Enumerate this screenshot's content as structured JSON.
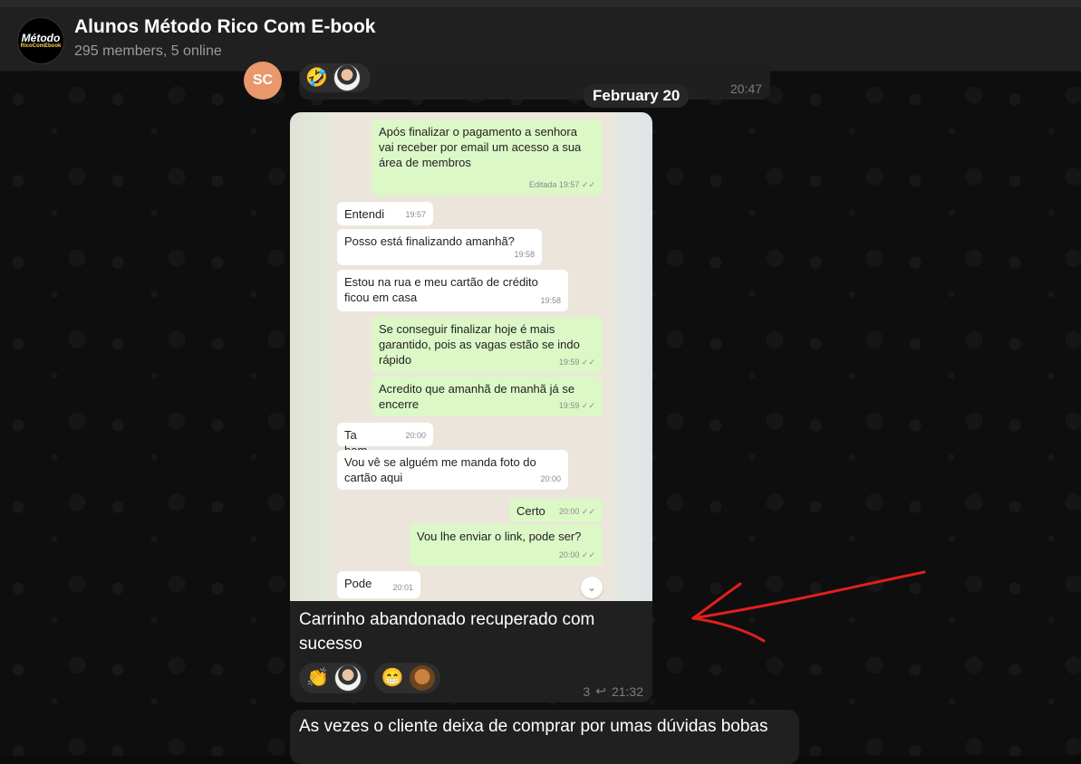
{
  "header": {
    "title": "Alunos Método Rico Com E-book",
    "subtitle": "295 members, 5 online",
    "logo_line1": "Método",
    "logo_line2": "RicoComEbook"
  },
  "previous_message": {
    "sender_initials": "SC",
    "reaction_emoji": "🤣",
    "time": "20:47"
  },
  "date_separator": "February 20",
  "message": {
    "caption": "Carrinho abandonado recuperado com sucesso",
    "reactions": [
      {
        "emoji": "👏"
      },
      {
        "emoji": "😁"
      }
    ],
    "replies": "3",
    "time": "21:32",
    "screenshot_chat": [
      {
        "dir": "out",
        "text": "Após finalizar o pagamento a senhora vai receber por email um acesso a sua área de membros",
        "time": "Editada 19:57 ✓✓"
      },
      {
        "dir": "in",
        "text": "Entendi",
        "time": "19:57"
      },
      {
        "dir": "in",
        "text": "Posso está finalizando amanhã?",
        "time": "19:58"
      },
      {
        "dir": "in",
        "text": "Estou na rua e meu cartão de crédito ficou em casa",
        "time": "19:58"
      },
      {
        "dir": "out",
        "text": "Se conseguir finalizar hoje é mais garantido, pois as vagas estão se indo rápido",
        "time": "19:59 ✓✓"
      },
      {
        "dir": "out",
        "text": "Acredito que amanhã de manhã já se encerre",
        "time": "19:59 ✓✓"
      },
      {
        "dir": "in",
        "text": "Ta bom",
        "time": "20:00"
      },
      {
        "dir": "in",
        "text": "Vou vê se alguém me manda foto do cartão aqui",
        "time": "20:00"
      },
      {
        "dir": "out",
        "text": "Certo",
        "time": "20:00 ✓✓"
      },
      {
        "dir": "out",
        "text": "Vou lhe enviar o link, pode ser?",
        "time": "20:00 ✓✓"
      },
      {
        "dir": "in",
        "text": "Pode",
        "time": "20:01"
      }
    ]
  },
  "next_message": {
    "text": "As vezes o cliente deixa de comprar por umas dúvidas bobas"
  },
  "colors": {
    "background": "#0e0e0e",
    "bubble": "#202020",
    "whatsapp_out": "#dcf8c6",
    "annotation_arrow": "#e0201c"
  }
}
